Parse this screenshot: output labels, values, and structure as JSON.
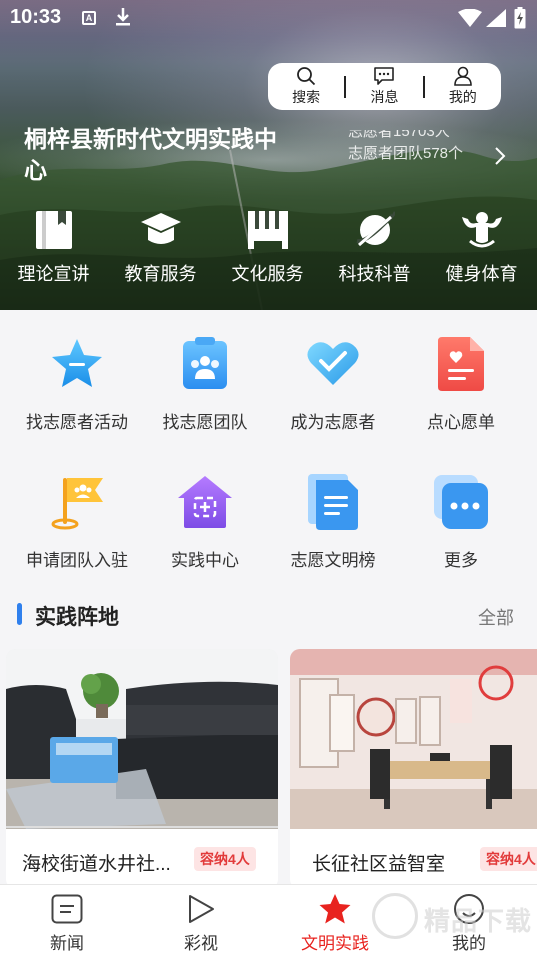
{
  "status_bar": {
    "time": "10:33",
    "a_label": "A"
  },
  "top_actions": [
    {
      "label": "搜索",
      "icon": "search-icon"
    },
    {
      "label": "消息",
      "icon": "message-icon"
    },
    {
      "label": "我的",
      "icon": "user-icon"
    }
  ],
  "hero": {
    "title": "桐梓县新时代文明实践中心",
    "stats_line1": "志愿者15703人",
    "stats_line2": "志愿者团队578个"
  },
  "hero_categories": [
    {
      "label": "理论宣讲",
      "icon": "book-icon"
    },
    {
      "label": "教育服务",
      "icon": "graduation-cap-icon"
    },
    {
      "label": "文化服务",
      "icon": "piano-icon"
    },
    {
      "label": "科技科普",
      "icon": "planet-icon"
    },
    {
      "label": "健身体育",
      "icon": "fitness-icon"
    }
  ],
  "services": [
    {
      "label": "找志愿者活动",
      "icon": "star-icon"
    },
    {
      "label": "找志愿团队",
      "icon": "team-clipboard-icon"
    },
    {
      "label": "成为志愿者",
      "icon": "heart-icon"
    },
    {
      "label": "点心愿单",
      "icon": "wish-list-icon"
    },
    {
      "label": "申请团队入驻",
      "icon": "flag-icon"
    },
    {
      "label": "实践中心",
      "icon": "house-icon"
    },
    {
      "label": "志愿文明榜",
      "icon": "document-icon"
    },
    {
      "label": "更多",
      "icon": "more-icon"
    }
  ],
  "section": {
    "title": "实践阵地",
    "more": "全部"
  },
  "cards": [
    {
      "name": "海校街道水井社...",
      "badge": "容纳4人",
      "image": "sofa-room-photo"
    },
    {
      "name": "长征社区益智室",
      "badge": "容纳4人",
      "image": "activity-room-photo"
    }
  ],
  "nav": [
    {
      "label": "新闻",
      "icon": "news-icon",
      "active": false
    },
    {
      "label": "彩视",
      "icon": "play-icon",
      "active": false
    },
    {
      "label": "文明实践",
      "icon": "star-filled-icon",
      "active": true
    },
    {
      "label": "我的",
      "icon": "profile-icon",
      "active": false
    }
  ],
  "watermark": "精品下载",
  "colors": {
    "accent_red": "#e8231f",
    "accent_blue": "#2f80ed",
    "badge_bg": "#fde4e4"
  }
}
